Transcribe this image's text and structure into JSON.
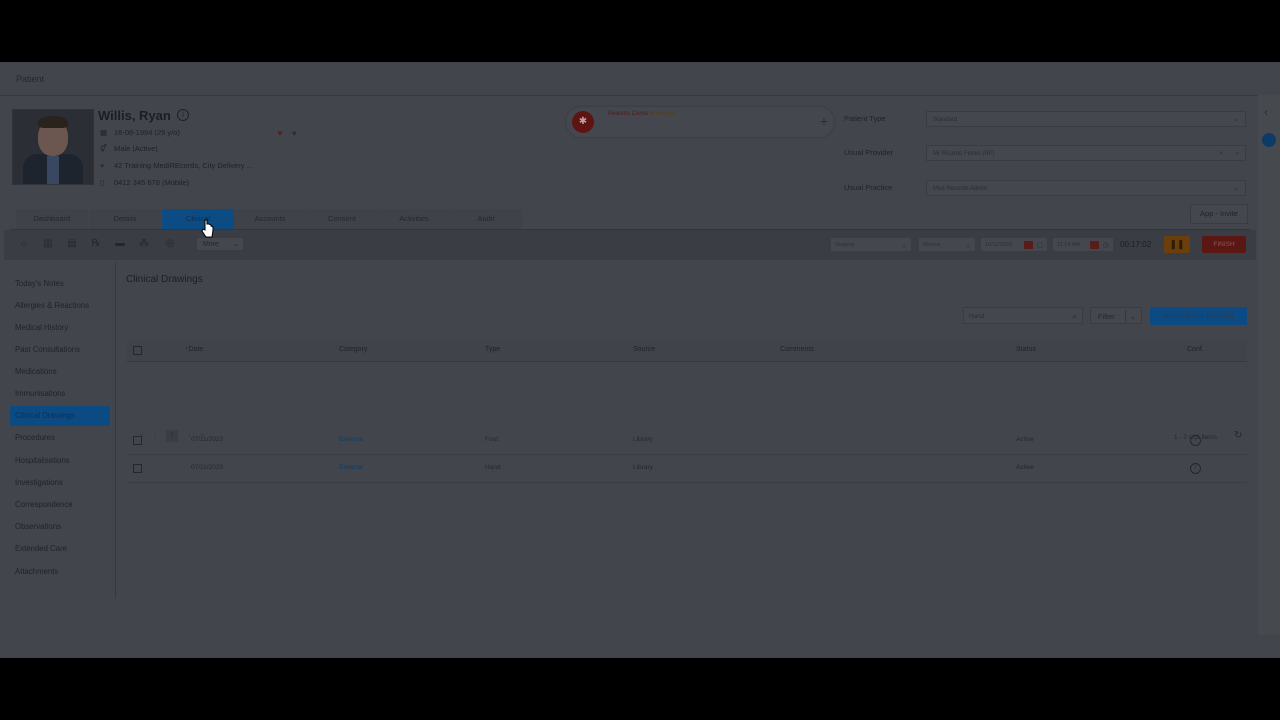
{
  "page": {
    "title": "Patient"
  },
  "patient": {
    "name": "Willis, Ryan",
    "dob": "16-08-1994 (29 y/o)",
    "gender": "Male (Active)",
    "address": "42 Training MediREcords, City Delivery ...",
    "phone": "0412 345 678 (Mobile)"
  },
  "alert": {
    "label": "Peanuts Coma",
    "severity": "Moderate",
    "icon": "alert-badge-icon"
  },
  "fields": {
    "patient_type_label": "Patient Type",
    "patient_type_value": "Standard",
    "usual_provider_label": "Usual Provider",
    "usual_provider_value": "Mr Ricardo Flores (RP)",
    "usual_practice_label": "Usual Practice",
    "usual_practice_value": "Med Records Admin"
  },
  "app_invite": "App - Invite",
  "tabs": [
    "Dashboard",
    "Details",
    "Clinical",
    "Accounts",
    "Consent",
    "Activities",
    "Audit"
  ],
  "active_tab": "Clinical",
  "toolbar": {
    "more": "More",
    "surgery": "Surgery",
    "room": "Rooms",
    "date1": "10/11/2023",
    "time1": "11:14 AM",
    "timer": "00:17:02",
    "finish": "FINISH"
  },
  "nav": [
    "Today's Notes",
    "Allergies & Reactions",
    "Medical History",
    "Past Consultations",
    "Medications",
    "Immunisations",
    "Clinical Drawings",
    "Procedures",
    "Hospitalisations",
    "Investigations",
    "Correspondence",
    "Observations",
    "Extended Care",
    "Attachments"
  ],
  "active_nav": "Clinical Drawings",
  "main": {
    "title": "Clinical Drawings",
    "search_value": "Hand",
    "filter": "Filter",
    "new_button": "New Clinical Drawing"
  },
  "table": {
    "headers": [
      "Date",
      "Category",
      "Type",
      "Source",
      "Comments",
      "Status",
      "Conf."
    ],
    "rows": [
      {
        "date": "07/11/2023",
        "category": "External",
        "type": "Foot",
        "source": "Library",
        "comments": "",
        "status": "Active"
      },
      {
        "date": "07/11/2023",
        "category": "External",
        "type": "Hand",
        "source": "Library",
        "comments": "",
        "status": "Active"
      }
    ]
  },
  "pager": {
    "current": "1",
    "summary": "1 - 2 of 2 items"
  },
  "colors": {
    "accent": "#0b4a82",
    "finish": "#5b1714",
    "pause": "#6a3f0c"
  }
}
